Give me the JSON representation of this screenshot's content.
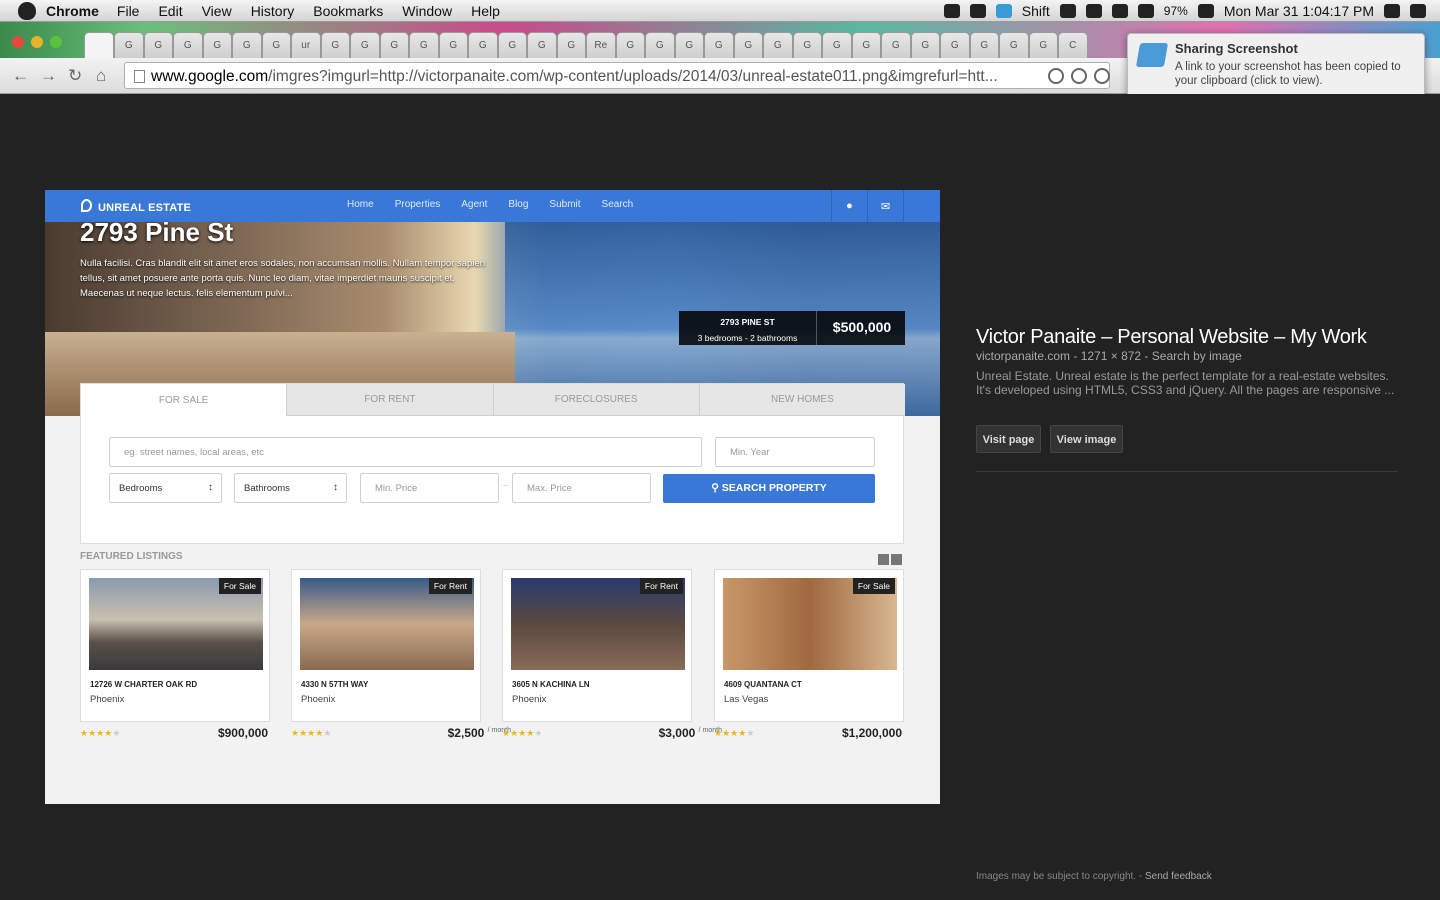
{
  "menubar": {
    "app": "Chrome",
    "items": [
      "File",
      "Edit",
      "View",
      "History",
      "Bookmarks",
      "Window",
      "Help"
    ],
    "status_user": "Shift",
    "battery": "97%",
    "clock": "Mon Mar 31  1:04:17 PM"
  },
  "tabs": {
    "labels": [
      "",
      "G",
      "G",
      "G",
      "G",
      "G",
      "G",
      "ur",
      "G",
      "G",
      "G",
      "G",
      "G",
      "G",
      "G",
      "G",
      "G",
      "Re",
      "G",
      "G",
      "G",
      "G",
      "G",
      "G",
      "G",
      "G",
      "G",
      "G",
      "G",
      "G",
      "G",
      "G",
      "G",
      "C"
    ]
  },
  "toolbar": {
    "url_host": "www.google.com",
    "url_rest": "/imgres?imgurl=http://victorpanaite.com/wp-content/uploads/2014/03/unreal-estate011.png&imgrefurl=htt..."
  },
  "notification": {
    "title": "Sharing Screenshot",
    "message": "A link to your screenshot has been copied to your clipboard (click to view)."
  },
  "site": {
    "logo": "UNREAL ESTATE",
    "nav": [
      "Home",
      "Properties",
      "Agent",
      "Blog",
      "Submit",
      "Search"
    ],
    "hero_title": "2793 Pine St",
    "hero_desc": "Nulla facilisi. Cras blandit elit sit amet eros sodales, non accumsan mollis. Nullam tempor sapien tellus, sit amet posuere ante porta quis. Nunc leo diam, vitae imperdiet mauris suscipit et. Maecenas ut neque lectus. felis elementum pulvi...",
    "hero_address": "2793 PINE ST",
    "hero_specs": "3 bedrooms - 2 bathrooms",
    "hero_price": "$500,000",
    "search_tabs": [
      "FOR SALE",
      "FOR RENT",
      "FORECLOSURES",
      "NEW HOMES"
    ],
    "search_placeholder": "eg. street names, local areas, etc",
    "min_year": "Min. Year",
    "bedrooms": "Bedrooms",
    "bathrooms": "Bathrooms",
    "min_price": "Min. Price",
    "dash": "–",
    "max_price": "Max. Price",
    "search_button": "SEARCH PROPERTY",
    "featured_title": "FEATURED LISTINGS",
    "listings": [
      {
        "badge": "For Sale",
        "address": "12726 W CHARTER OAK RD",
        "city": "Phoenix",
        "price": "$900,000",
        "per": "",
        "rating": 4
      },
      {
        "badge": "For Rent",
        "address": "4330 N 57TH WAY",
        "city": "Phoenix",
        "price": "$2,500",
        "per": "/ month",
        "rating": 4
      },
      {
        "badge": "For Rent",
        "address": "3605 N KACHINA LN",
        "city": "Phoenix",
        "price": "$3,000",
        "per": "/ month",
        "rating": 4
      },
      {
        "badge": "For Sale",
        "address": "4609 QUANTANA CT",
        "city": "Las Vegas",
        "price": "$1,200,000",
        "per": "",
        "rating": 4
      }
    ]
  },
  "info": {
    "title": "Victor Panaite – Personal Website – My Work",
    "meta": "victorpanaite.com - 1271 × 872 - Search by image",
    "desc": "Unreal Estate. Unreal estate is the perfect template for a real-estate websites. It's developed using HTML5, CSS3 and jQuery. All the pages are responsive ...",
    "visit": "Visit page",
    "view": "View image"
  },
  "footer": {
    "copy": "Images may be subject to copyright.",
    "sep": " - ",
    "feedback": "Send feedback"
  },
  "colors": {
    "accent": "#3a78d8",
    "viewer_bg": "#222222"
  }
}
